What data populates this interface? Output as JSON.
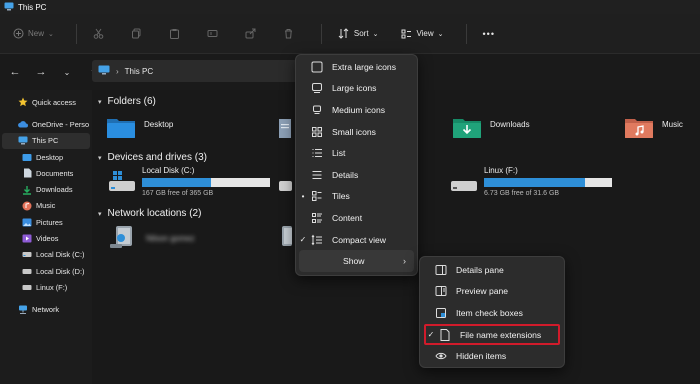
{
  "window": {
    "title": "This PC"
  },
  "toolbar": {
    "new_label": "New",
    "sort_label": "Sort",
    "view_label": "View",
    "more_label": "•••"
  },
  "address": {
    "path_label": "This PC"
  },
  "sidebar": {
    "items": [
      {
        "label": "Quick access",
        "icon": "star-icon",
        "color": "#f4c430"
      },
      {
        "label": "OneDrive - Perso",
        "icon": "cloud-icon",
        "color": "#3c8ee0"
      },
      {
        "label": "This PC",
        "icon": "monitor-icon",
        "color": "#45a2e8"
      },
      {
        "label": "Desktop",
        "icon": "desktop-folder-icon",
        "color": "#3d9be9"
      },
      {
        "label": "Documents",
        "icon": "document-icon",
        "color": "#cfd8e0"
      },
      {
        "label": "Downloads",
        "icon": "download-icon",
        "color": "#27ae60"
      },
      {
        "label": "Music",
        "icon": "music-icon",
        "color": "#e3725a"
      },
      {
        "label": "Pictures",
        "icon": "picture-icon",
        "color": "#3a8ee0"
      },
      {
        "label": "Videos",
        "icon": "video-icon",
        "color": "#8f5cd6"
      },
      {
        "label": "Local Disk (C:)",
        "icon": "drive-icon",
        "color": "#c8c8c8"
      },
      {
        "label": "Local Disk (D:)",
        "icon": "drive-icon",
        "color": "#c8c8c8"
      },
      {
        "label": "Linux (F:)",
        "icon": "drive-icon",
        "color": "#c8c8c8"
      },
      {
        "label": "Network",
        "icon": "network-icon",
        "color": "#45a2e8"
      }
    ]
  },
  "groups": {
    "folders": "Folders (6)",
    "drives": "Devices and drives (3)",
    "network": "Network locations (2)"
  },
  "folders": [
    {
      "label": "Desktop",
      "color": "#1f86d6"
    },
    {
      "label": "",
      "color": "#8c9fb5"
    },
    {
      "label": "Downloads",
      "color": "#1fa37a"
    },
    {
      "label": "Music",
      "color": "#e07a5f"
    }
  ],
  "drives": [
    {
      "name": "Local Disk (C:)",
      "free": "167 GB free of 365 GB",
      "used_fraction": 0.54
    },
    {
      "name": "Linux (F:)",
      "free": "6.73 GB free of 31.6 GB",
      "used_fraction": 0.79
    }
  ],
  "network_locations": [
    {
      "label": "Nilson gomez"
    }
  ],
  "view_menu": {
    "items": [
      {
        "label": "Extra large icons",
        "icon": "extra-large-icons-icon",
        "check": ""
      },
      {
        "label": "Large icons",
        "icon": "large-icons-icon",
        "check": ""
      },
      {
        "label": "Medium icons",
        "icon": "medium-icons-icon",
        "check": ""
      },
      {
        "label": "Small icons",
        "icon": "small-icons-icon",
        "check": ""
      },
      {
        "label": "List",
        "icon": "list-icon",
        "check": ""
      },
      {
        "label": "Details",
        "icon": "details-icon",
        "check": ""
      },
      {
        "label": "Tiles",
        "icon": "tiles-icon",
        "check": "•"
      },
      {
        "label": "Content",
        "icon": "content-icon",
        "check": ""
      },
      {
        "label": "Compact view",
        "icon": "compact-view-icon",
        "check": "✓"
      },
      {
        "label": "Show",
        "icon": "",
        "check": ""
      }
    ]
  },
  "show_menu": {
    "items": [
      {
        "label": "Details pane",
        "icon": "details-pane-icon",
        "check": ""
      },
      {
        "label": "Preview pane",
        "icon": "preview-pane-icon",
        "check": ""
      },
      {
        "label": "Item check boxes",
        "icon": "checkbox-icon",
        "check": ""
      },
      {
        "label": "File name extensions",
        "icon": "file-icon",
        "check": "✓"
      },
      {
        "label": "Hidden items",
        "icon": "eye-icon",
        "check": ""
      }
    ]
  },
  "colors": {
    "accent": "#2e8fd8",
    "highlight_border": "#d11b2b"
  }
}
